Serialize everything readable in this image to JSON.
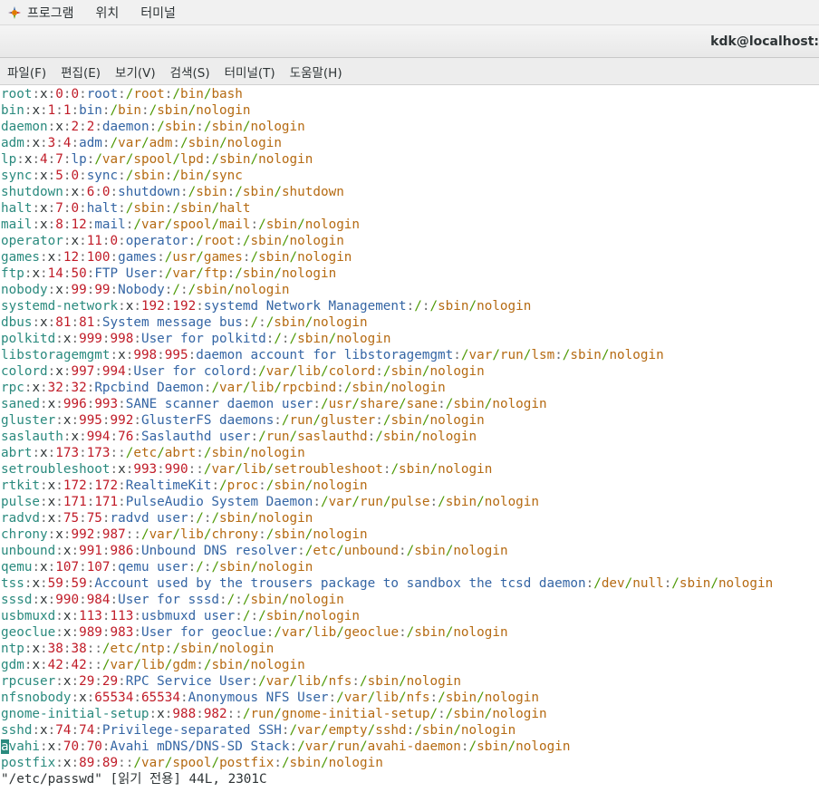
{
  "topbar": {
    "menus": [
      "프로그램",
      "위치",
      "터미널"
    ]
  },
  "window": {
    "title": "kdk@localhost:"
  },
  "menubar": {
    "items": [
      "파일(F)",
      "편집(E)",
      "보기(V)",
      "검색(S)",
      "터미널(T)",
      "도움말(H)"
    ]
  },
  "terminal": {
    "lines": [
      "root:x:0:0:root:/root:/bin/bash",
      "bin:x:1:1:bin:/bin:/sbin/nologin",
      "daemon:x:2:2:daemon:/sbin:/sbin/nologin",
      "adm:x:3:4:adm:/var/adm:/sbin/nologin",
      "lp:x:4:7:lp:/var/spool/lpd:/sbin/nologin",
      "sync:x:5:0:sync:/sbin:/bin/sync",
      "shutdown:x:6:0:shutdown:/sbin:/sbin/shutdown",
      "halt:x:7:0:halt:/sbin:/sbin/halt",
      "mail:x:8:12:mail:/var/spool/mail:/sbin/nologin",
      "operator:x:11:0:operator:/root:/sbin/nologin",
      "games:x:12:100:games:/usr/games:/sbin/nologin",
      "ftp:x:14:50:FTP User:/var/ftp:/sbin/nologin",
      "nobody:x:99:99:Nobody:/:/sbin/nologin",
      "systemd-network:x:192:192:systemd Network Management:/:/sbin/nologin",
      "dbus:x:81:81:System message bus:/:/sbin/nologin",
      "polkitd:x:999:998:User for polkitd:/:/sbin/nologin",
      "libstoragemgmt:x:998:995:daemon account for libstoragemgmt:/var/run/lsm:/sbin/nologin",
      "colord:x:997:994:User for colord:/var/lib/colord:/sbin/nologin",
      "rpc:x:32:32:Rpcbind Daemon:/var/lib/rpcbind:/sbin/nologin",
      "saned:x:996:993:SANE scanner daemon user:/usr/share/sane:/sbin/nologin",
      "gluster:x:995:992:GlusterFS daemons:/run/gluster:/sbin/nologin",
      "saslauth:x:994:76:Saslauthd user:/run/saslauthd:/sbin/nologin",
      "abrt:x:173:173::/etc/abrt:/sbin/nologin",
      "setroubleshoot:x:993:990::/var/lib/setroubleshoot:/sbin/nologin",
      "rtkit:x:172:172:RealtimeKit:/proc:/sbin/nologin",
      "pulse:x:171:171:PulseAudio System Daemon:/var/run/pulse:/sbin/nologin",
      "radvd:x:75:75:radvd user:/:/sbin/nologin",
      "chrony:x:992:987::/var/lib/chrony:/sbin/nologin",
      "unbound:x:991:986:Unbound DNS resolver:/etc/unbound:/sbin/nologin",
      "qemu:x:107:107:qemu user:/:/sbin/nologin",
      "tss:x:59:59:Account used by the trousers package to sandbox the tcsd daemon:/dev/null:/sbin/nologin",
      "sssd:x:990:984:User for sssd:/:/sbin/nologin",
      "usbmuxd:x:113:113:usbmuxd user:/:/sbin/nologin",
      "geoclue:x:989:983:User for geoclue:/var/lib/geoclue:/sbin/nologin",
      "ntp:x:38:38::/etc/ntp:/sbin/nologin",
      "gdm:x:42:42::/var/lib/gdm:/sbin/nologin",
      "rpcuser:x:29:29:RPC Service User:/var/lib/nfs:/sbin/nologin",
      "nfsnobody:x:65534:65534:Anonymous NFS User:/var/lib/nfs:/sbin/nologin",
      "gnome-initial-setup:x:988:982::/run/gnome-initial-setup/:/sbin/nologin",
      "sshd:x:74:74:Privilege-separated SSH:/var/empty/sshd:/sbin/nologin",
      "avahi:x:70:70:Avahi mDNS/DNS-SD Stack:/var/run/avahi-daemon:/sbin/nologin",
      "postfix:x:89:89::/var/spool/postfix:/sbin/nologin"
    ],
    "cursor_line": 40,
    "status_line": "\"/etc/passwd\" [읽기 전용] 44L, 2301C"
  },
  "colors": {
    "username": "#2a8a7e",
    "numbers": "#c01c28",
    "gecos": "#3465a4",
    "path_slash": "#4e9a06",
    "path_text": "#b56a12",
    "cursor": "#2a8a7e"
  }
}
